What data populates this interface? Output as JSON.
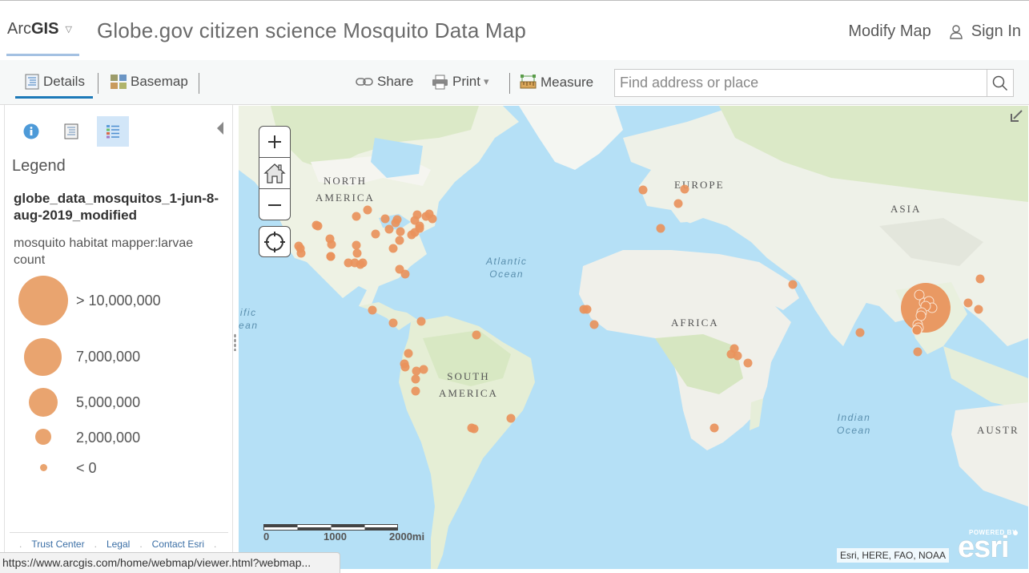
{
  "header": {
    "brand_prefix": "Arc",
    "brand_bold": "GIS",
    "brand_caret": "▽",
    "title": "Globe.gov citizen science Mosquito Data Map",
    "modify_map": "Modify Map",
    "sign_in": "Sign In"
  },
  "toolbar": {
    "details": "Details",
    "basemap": "Basemap",
    "share": "Share",
    "print": "Print",
    "print_caret": "▾",
    "measure": "Measure",
    "search_placeholder": "Find address or place",
    "search_value": ""
  },
  "sidebar": {
    "tabs": [
      {
        "name": "about",
        "icon": "info-icon",
        "active": false
      },
      {
        "name": "content",
        "icon": "content-list-icon",
        "active": false
      },
      {
        "name": "legend",
        "icon": "legend-icon",
        "active": true
      }
    ],
    "heading": "Legend",
    "layer_title": "globe_data_mosquitos_1-jun-8-aug-2019_modified",
    "field_title": "mosquito habitat mapper:larvae count",
    "legend_items": [
      {
        "label": "> 10,000,000"
      },
      {
        "label": "7,000,000"
      },
      {
        "label": "5,000,000"
      },
      {
        "label": "2,000,000"
      },
      {
        "label": "< 0"
      }
    ],
    "symbol_color": "#e9a46f",
    "footer_links": [
      "Trust Center",
      "Legal",
      "Contact Esri"
    ]
  },
  "map": {
    "labels": {
      "north_america": "NORTH\nAMERICA",
      "europe": "EUROPE",
      "asia": "ASIA",
      "africa": "AFRICA",
      "south_america": "SOUTH\nAMERICA",
      "australia": "AUSTR",
      "atlantic": "Atlantic\nOcean",
      "pacific": "ific\nean",
      "indian": "Indian\nOcean"
    },
    "scale": {
      "labels": [
        "0",
        "1000",
        "2000mi"
      ]
    },
    "attribution": "Esri, HERE, FAO, NOAA",
    "logo_top": "POWERED BY",
    "logo_main": "esri",
    "point_color": "#e9935c"
  },
  "statusbar": {
    "url": "https://www.arcgis.com/home/webmap/viewer.html?webmap..."
  }
}
